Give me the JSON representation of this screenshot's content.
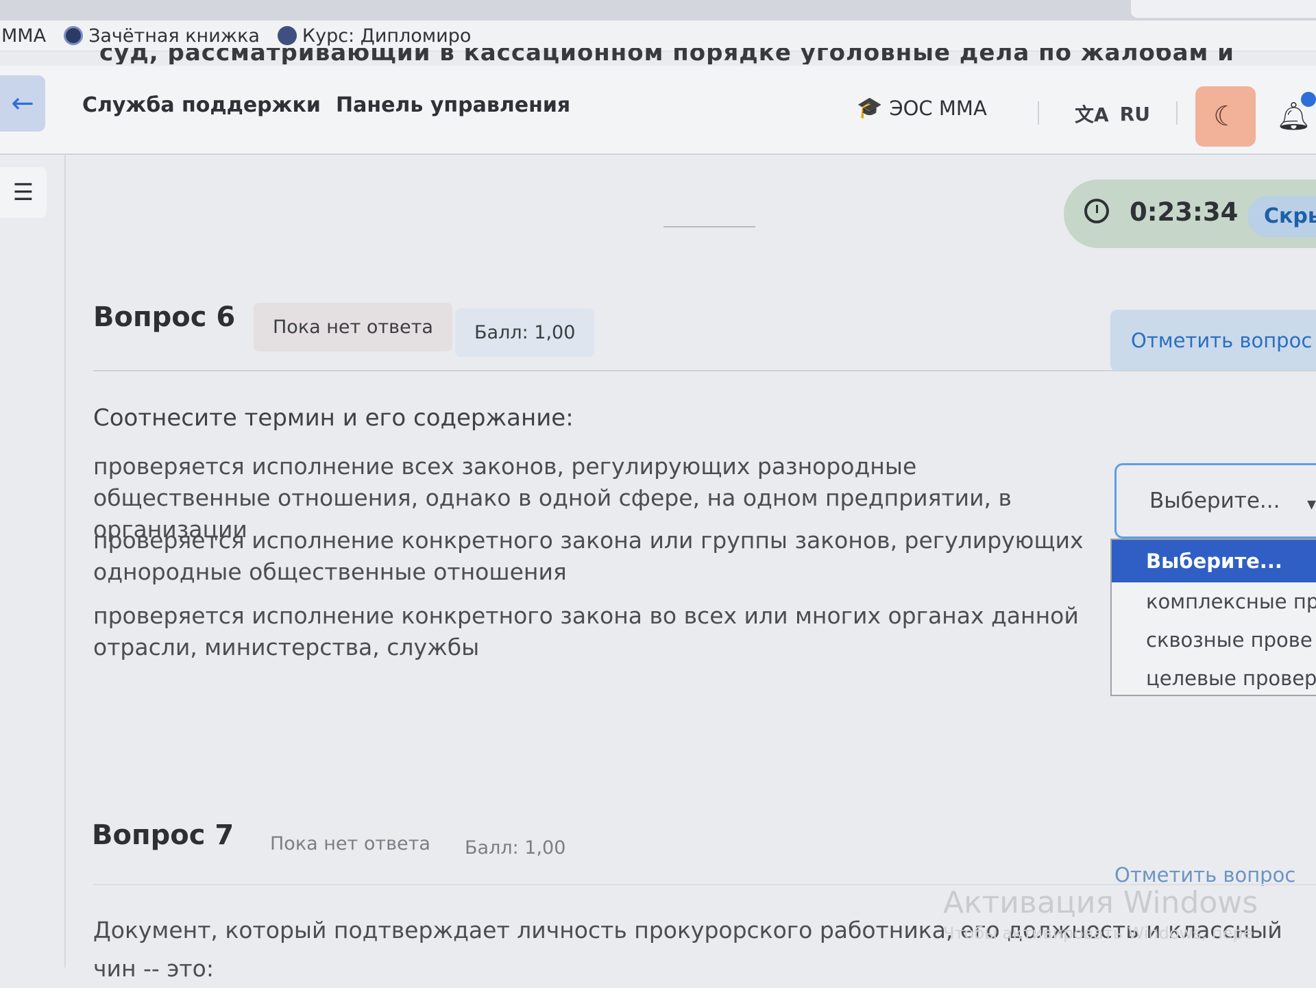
{
  "browser": {
    "bookmarks": [
      {
        "label": "ММА",
        "icon": "none"
      },
      {
        "label": "Зачётная книжка",
        "icon": "record-book-icon"
      },
      {
        "label": "Курс: Дипломиро",
        "icon": "graduation-cap-icon"
      }
    ],
    "ghost_line": "суд, рассматривающий в кассационном порядке уголовные дела по жалобам и"
  },
  "nav": {
    "back_icon": "arrow-left-icon",
    "support": "Служба поддержки",
    "dashboard": "Панель управления",
    "eos": "ЭОС ММА",
    "lang": "RU",
    "theme_icon": "moon-icon",
    "bell_icon": "bell-icon"
  },
  "timer": {
    "time": "0:23:34",
    "hide_label": "Скры"
  },
  "question6": {
    "title": "Вопрос 6",
    "status": "Пока нет ответа",
    "score": "Балл: 1,00",
    "flag_label": "Отметить вопрос",
    "prompt": "Соотнесите термин и его содержание:",
    "stems": [
      "проверяется исполнение всех законов, регулирующих разнородные общественные отношения, однако в одной сфере, на одном предприятии, в организации",
      "проверяется исполнение конкретного закона или группы законов, регулирующих однородные общественные отношения",
      "проверяется исполнение конкретного закона во всех или многих органах данной отрасли, министерства, службы"
    ],
    "select_value": "Выберите...",
    "options": [
      "Выберите...",
      "комплексные пр",
      "сквозные прове",
      "целевые провер"
    ]
  },
  "question7": {
    "title": "Вопрос 7",
    "status": "Пока нет ответа",
    "score": "Балл: 1,00",
    "flag_label": "Отметить вопрос",
    "text": "Документ, который подтверждает личность прокурорского работника, его должность и классный чин -- это:"
  },
  "watermark": {
    "title": "Активация Windows",
    "subtitle": "Чтобы активировать Windows, пере"
  }
}
